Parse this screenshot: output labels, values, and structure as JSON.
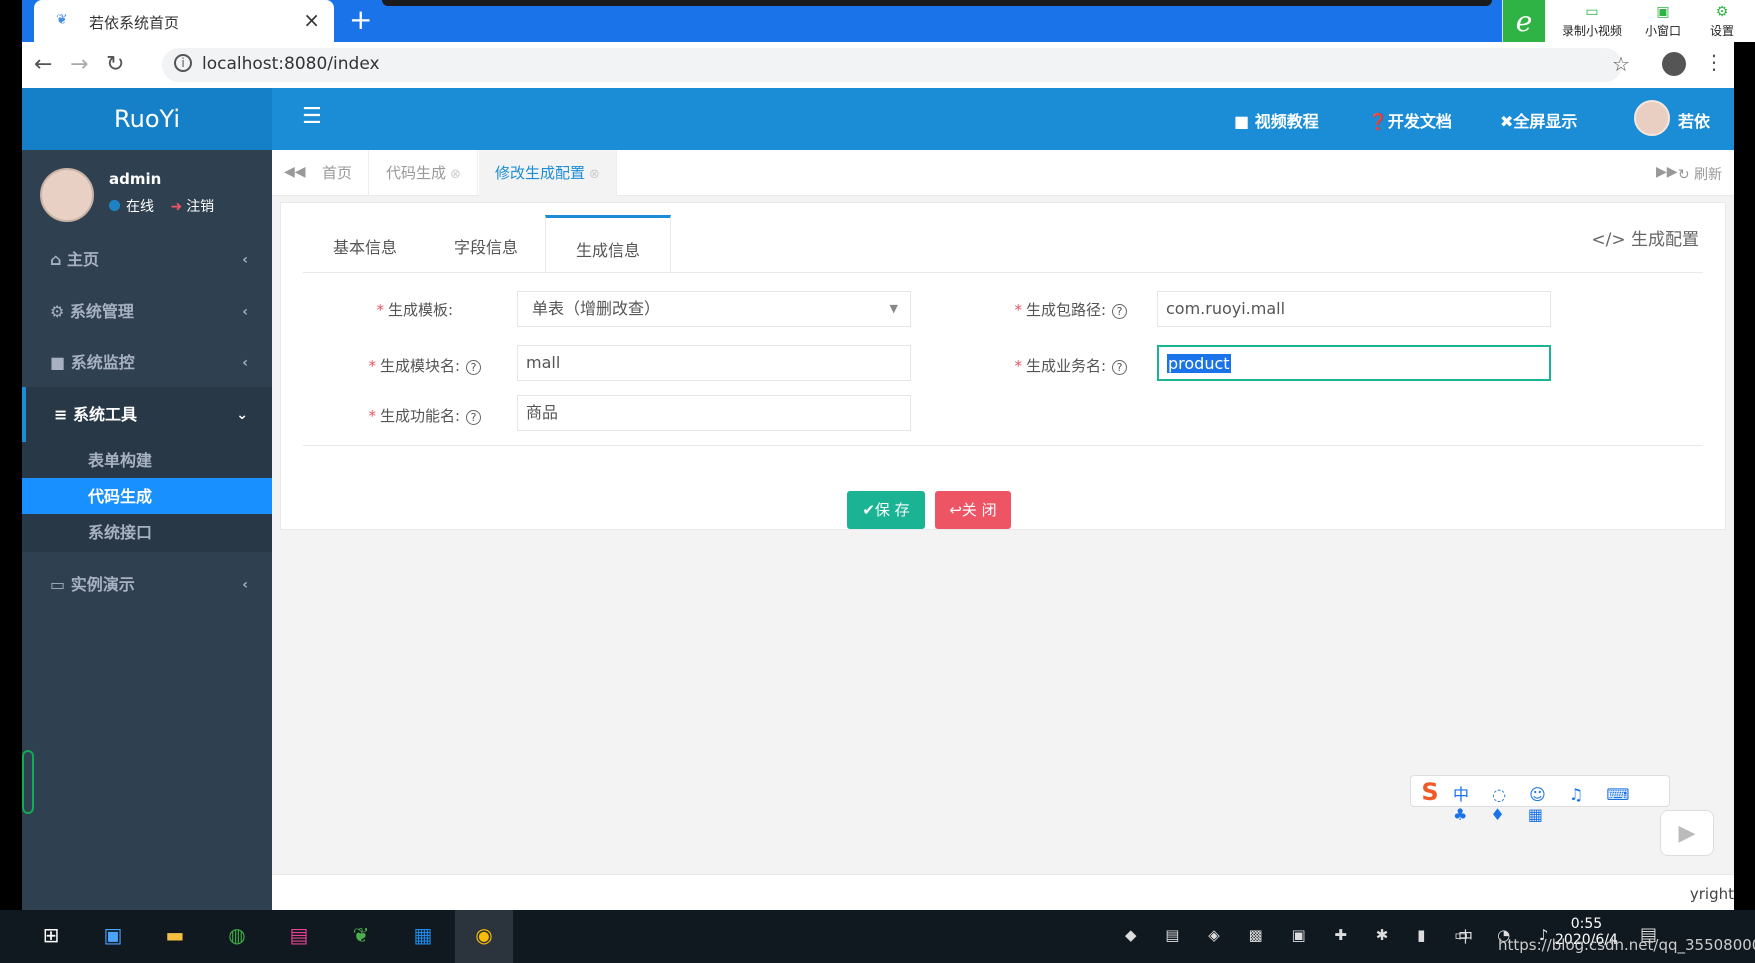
{
  "browser": {
    "tab_title": "若依系统首页",
    "url": "localhost:8080/index",
    "new_tab": "+",
    "close": "×"
  },
  "recorder": {
    "logo": "e",
    "buttons": [
      "录制小视频",
      "小窗口",
      "设置"
    ]
  },
  "app": {
    "brand": "RuoYi",
    "header_links": [
      "视频教程",
      "开发文档",
      "全屏显示"
    ],
    "header_user": "若依"
  },
  "sidebar": {
    "user": "admin",
    "status": "在线",
    "logout": "注销",
    "items": [
      {
        "icon": "home-icon",
        "label": "主页"
      },
      {
        "icon": "gear-icon",
        "label": "系统管理"
      },
      {
        "icon": "video-icon",
        "label": "系统监控"
      },
      {
        "icon": "list-icon",
        "label": "系统工具"
      },
      {
        "icon": "desktop-icon",
        "label": "实例演示"
      }
    ],
    "subitems": [
      "表单构建",
      "代码生成",
      "系统接口"
    ]
  },
  "page_tabs": {
    "items": [
      "首页",
      "代码生成",
      "修改生成配置"
    ],
    "refresh": "刷新"
  },
  "form": {
    "tabs": [
      "基本信息",
      "字段信息",
      "生成信息"
    ],
    "corner": "生成配置",
    "template_label": "生成模板:",
    "template_value": "单表（增删改查）",
    "package_label": "生成包路径:",
    "package_value": "com.ruoyi.mall",
    "module_label": "生成模块名:",
    "module_value": "mall",
    "business_label": "生成业务名:",
    "business_value": "product",
    "function_label": "生成功能名:",
    "function_value": "商品",
    "required_mark": "*",
    "help_mark": "?",
    "save": "保 存",
    "close": "关 闭"
  },
  "footer": {
    "copyright": "yright"
  },
  "taskbar": {
    "time": "0:55",
    "date": "2020/6/4",
    "ime_lang": "中",
    "watermark": "https://blog.csdn.net/qq_35508000"
  }
}
